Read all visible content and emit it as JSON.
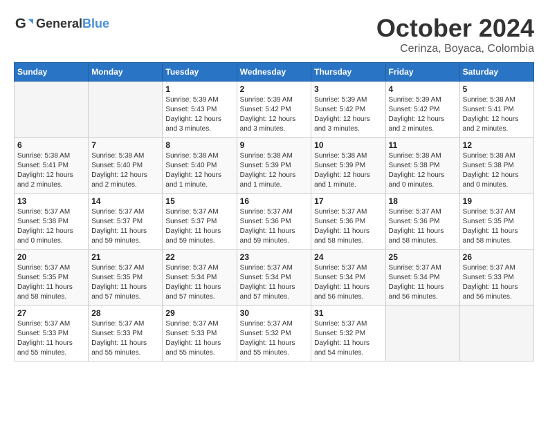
{
  "header": {
    "logo_general": "General",
    "logo_blue": "Blue",
    "title": "October 2024",
    "subtitle": "Cerinza, Boyaca, Colombia"
  },
  "calendar": {
    "days_of_week": [
      "Sunday",
      "Monday",
      "Tuesday",
      "Wednesday",
      "Thursday",
      "Friday",
      "Saturday"
    ],
    "weeks": [
      [
        {
          "day": "",
          "info": ""
        },
        {
          "day": "",
          "info": ""
        },
        {
          "day": "1",
          "info": "Sunrise: 5:39 AM\nSunset: 5:43 PM\nDaylight: 12 hours and 3 minutes."
        },
        {
          "day": "2",
          "info": "Sunrise: 5:39 AM\nSunset: 5:42 PM\nDaylight: 12 hours and 3 minutes."
        },
        {
          "day": "3",
          "info": "Sunrise: 5:39 AM\nSunset: 5:42 PM\nDaylight: 12 hours and 3 minutes."
        },
        {
          "day": "4",
          "info": "Sunrise: 5:39 AM\nSunset: 5:42 PM\nDaylight: 12 hours and 2 minutes."
        },
        {
          "day": "5",
          "info": "Sunrise: 5:38 AM\nSunset: 5:41 PM\nDaylight: 12 hours and 2 minutes."
        }
      ],
      [
        {
          "day": "6",
          "info": "Sunrise: 5:38 AM\nSunset: 5:41 PM\nDaylight: 12 hours and 2 minutes."
        },
        {
          "day": "7",
          "info": "Sunrise: 5:38 AM\nSunset: 5:40 PM\nDaylight: 12 hours and 2 minutes."
        },
        {
          "day": "8",
          "info": "Sunrise: 5:38 AM\nSunset: 5:40 PM\nDaylight: 12 hours and 1 minute."
        },
        {
          "day": "9",
          "info": "Sunrise: 5:38 AM\nSunset: 5:39 PM\nDaylight: 12 hours and 1 minute."
        },
        {
          "day": "10",
          "info": "Sunrise: 5:38 AM\nSunset: 5:39 PM\nDaylight: 12 hours and 1 minute."
        },
        {
          "day": "11",
          "info": "Sunrise: 5:38 AM\nSunset: 5:38 PM\nDaylight: 12 hours and 0 minutes."
        },
        {
          "day": "12",
          "info": "Sunrise: 5:38 AM\nSunset: 5:38 PM\nDaylight: 12 hours and 0 minutes."
        }
      ],
      [
        {
          "day": "13",
          "info": "Sunrise: 5:37 AM\nSunset: 5:38 PM\nDaylight: 12 hours and 0 minutes."
        },
        {
          "day": "14",
          "info": "Sunrise: 5:37 AM\nSunset: 5:37 PM\nDaylight: 11 hours and 59 minutes."
        },
        {
          "day": "15",
          "info": "Sunrise: 5:37 AM\nSunset: 5:37 PM\nDaylight: 11 hours and 59 minutes."
        },
        {
          "day": "16",
          "info": "Sunrise: 5:37 AM\nSunset: 5:36 PM\nDaylight: 11 hours and 59 minutes."
        },
        {
          "day": "17",
          "info": "Sunrise: 5:37 AM\nSunset: 5:36 PM\nDaylight: 11 hours and 58 minutes."
        },
        {
          "day": "18",
          "info": "Sunrise: 5:37 AM\nSunset: 5:36 PM\nDaylight: 11 hours and 58 minutes."
        },
        {
          "day": "19",
          "info": "Sunrise: 5:37 AM\nSunset: 5:35 PM\nDaylight: 11 hours and 58 minutes."
        }
      ],
      [
        {
          "day": "20",
          "info": "Sunrise: 5:37 AM\nSunset: 5:35 PM\nDaylight: 11 hours and 58 minutes."
        },
        {
          "day": "21",
          "info": "Sunrise: 5:37 AM\nSunset: 5:35 PM\nDaylight: 11 hours and 57 minutes."
        },
        {
          "day": "22",
          "info": "Sunrise: 5:37 AM\nSunset: 5:34 PM\nDaylight: 11 hours and 57 minutes."
        },
        {
          "day": "23",
          "info": "Sunrise: 5:37 AM\nSunset: 5:34 PM\nDaylight: 11 hours and 57 minutes."
        },
        {
          "day": "24",
          "info": "Sunrise: 5:37 AM\nSunset: 5:34 PM\nDaylight: 11 hours and 56 minutes."
        },
        {
          "day": "25",
          "info": "Sunrise: 5:37 AM\nSunset: 5:34 PM\nDaylight: 11 hours and 56 minutes."
        },
        {
          "day": "26",
          "info": "Sunrise: 5:37 AM\nSunset: 5:33 PM\nDaylight: 11 hours and 56 minutes."
        }
      ],
      [
        {
          "day": "27",
          "info": "Sunrise: 5:37 AM\nSunset: 5:33 PM\nDaylight: 11 hours and 55 minutes."
        },
        {
          "day": "28",
          "info": "Sunrise: 5:37 AM\nSunset: 5:33 PM\nDaylight: 11 hours and 55 minutes."
        },
        {
          "day": "29",
          "info": "Sunrise: 5:37 AM\nSunset: 5:33 PM\nDaylight: 11 hours and 55 minutes."
        },
        {
          "day": "30",
          "info": "Sunrise: 5:37 AM\nSunset: 5:32 PM\nDaylight: 11 hours and 55 minutes."
        },
        {
          "day": "31",
          "info": "Sunrise: 5:37 AM\nSunset: 5:32 PM\nDaylight: 11 hours and 54 minutes."
        },
        {
          "day": "",
          "info": ""
        },
        {
          "day": "",
          "info": ""
        }
      ]
    ]
  }
}
